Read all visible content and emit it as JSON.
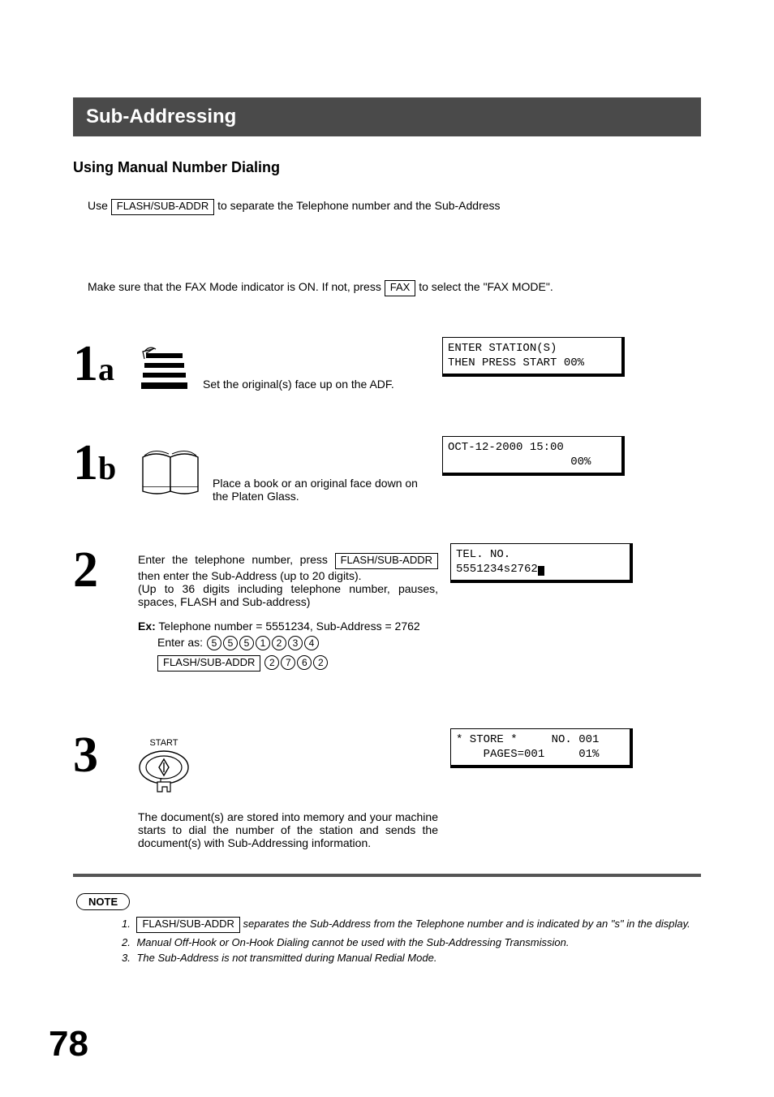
{
  "title": "Sub-Addressing",
  "section": "Using Manual Number Dialing",
  "intro_pre": "Use ",
  "intro_key": "FLASH/SUB-ADDR",
  "intro_post": " to separate the Telephone number and the Sub-Address",
  "mode_pre": "Make sure that the FAX Mode indicator is ON.  If not, press ",
  "mode_key": "FAX",
  "mode_post": " to select the \"FAX MODE\".",
  "steps": {
    "s1a": {
      "num": "1",
      "suffix": "a",
      "text": " Set the original(s) face up on the ADF.",
      "display": "ENTER STATION(S)\nTHEN PRESS START 00%"
    },
    "s1b": {
      "num": "1",
      "suffix": "b",
      "text": " Place a book or an original  face down on the Platen Glass.",
      "display": "OCT-12-2000 15:00\n                  00%"
    },
    "s2": {
      "num": "2",
      "line1_pre": "Enter the telephone number, press ",
      "line1_key": "FLASH/SUB-ADDR",
      "line2": "then enter the Sub-Address (up to 20 digits).",
      "line3": "(Up to 36 digits including telephone number, pauses, spaces, FLASH and Sub-address)",
      "ex_label": "Ex:",
      "ex_text": " Telephone number = 5551234, Sub-Address = 2762",
      "enter_as": "Enter as:",
      "digits1": [
        "5",
        "5",
        "5",
        "1",
        "2",
        "3",
        "4"
      ],
      "flash_key": "FLASH/SUB-ADDR",
      "digits2": [
        "2",
        "7",
        "6",
        "2"
      ],
      "display_line1": "TEL. NO.",
      "display_line2": "5551234s2762"
    },
    "s3": {
      "num": "3",
      "start_label": "START",
      "text": "The document(s) are stored into memory and your machine starts to dial the number of the station and sends the document(s) with Sub-Addressing information.",
      "display": "* STORE *     NO. 001\n    PAGES=001     01%"
    }
  },
  "note_label": "NOTE",
  "notes": {
    "n1_num": "1.",
    "n1_key": "FLASH/SUB-ADDR",
    "n1_post": " separates the Sub-Address from the Telephone number and is indicated by an \"s\" in the display.",
    "n2_num": "2.",
    "n2": "Manual Off-Hook or On-Hook Dialing cannot be used with the Sub-Addressing Transmission.",
    "n3_num": "3.",
    "n3": "The Sub-Address is not transmitted during Manual Redial Mode."
  },
  "page_number": "78"
}
